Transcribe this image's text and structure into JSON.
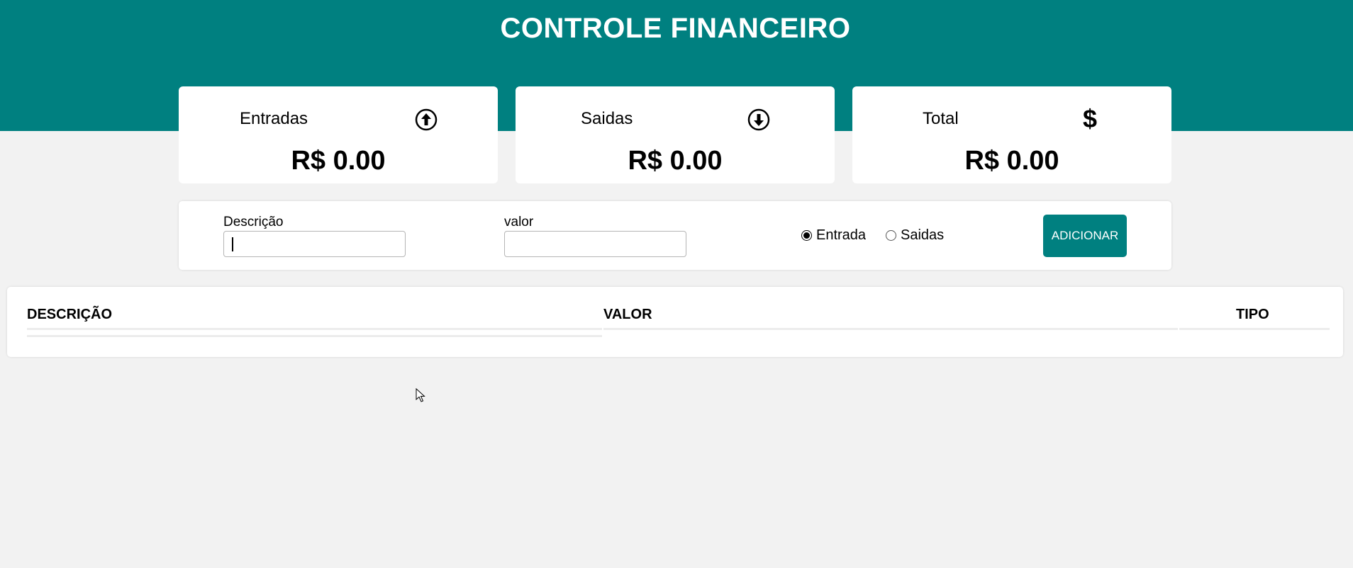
{
  "header": {
    "title": "CONTROLE FINANCEIRO",
    "bg_color": "#008080"
  },
  "summary": {
    "cards": [
      {
        "label": "Entradas",
        "icon": "arrow-up-circle-icon",
        "value": "R$ 0.00"
      },
      {
        "label": "Saidas",
        "icon": "arrow-down-circle-icon",
        "value": "R$ 0.00"
      },
      {
        "label": "Total",
        "icon": "dollar-icon",
        "icon_glyph": "$",
        "value": "R$ 0.00"
      }
    ]
  },
  "form": {
    "description_label": "Descrição",
    "description_value": "",
    "amount_label": "valor",
    "amount_value": "",
    "type_options": [
      {
        "label": "Entrada",
        "checked": true
      },
      {
        "label": "Saidas",
        "checked": false
      }
    ],
    "add_button_label": "ADICIONAR"
  },
  "table": {
    "columns": [
      "DESCRIÇÃO",
      "VALOR",
      "TIPO"
    ],
    "rows": []
  },
  "colors": {
    "accent": "#008080",
    "background": "#f2f2f2",
    "card": "#ffffff"
  }
}
